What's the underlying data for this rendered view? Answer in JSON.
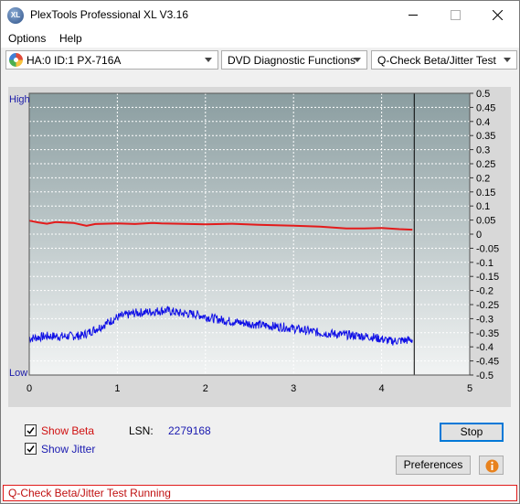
{
  "window": {
    "title": "PlexTools Professional XL V3.16",
    "icon": "plextools-xl-icon"
  },
  "menu": {
    "options": "Options",
    "help": "Help"
  },
  "toolbar": {
    "drive": "HA:0 ID:1  PX-716A",
    "function": "DVD Diagnostic Functions",
    "test": "Q-Check Beta/Jitter Test"
  },
  "chart": {
    "high_label": "High",
    "low_label": "Low",
    "x_ticks": [
      "0",
      "1",
      "2",
      "3",
      "4",
      "5"
    ],
    "y_ticks": [
      "0.5",
      "0.45",
      "0.4",
      "0.35",
      "0.3",
      "0.25",
      "0.2",
      "0.15",
      "0.1",
      "0.05",
      "0",
      "-0.05",
      "-0.1",
      "-0.15",
      "-0.2",
      "-0.25",
      "-0.3",
      "-0.35",
      "-0.4",
      "-0.45",
      "-0.5"
    ]
  },
  "chart_data": {
    "type": "line",
    "xlim": [
      0,
      5
    ],
    "ylim": [
      -0.5,
      0.5
    ],
    "grid": true,
    "end_marker_x": 4.37,
    "series": [
      {
        "color": "#e31b1b",
        "x": [
          0,
          0.1,
          0.2,
          0.3,
          0.5,
          0.65,
          0.75,
          1.0,
          1.2,
          1.4,
          1.5,
          1.7,
          2.0,
          2.3,
          2.6,
          3.0,
          3.3,
          3.6,
          3.8,
          4.0,
          4.2,
          4.35
        ],
        "values": [
          0.048,
          0.042,
          0.037,
          0.043,
          0.04,
          0.03,
          0.036,
          0.038,
          0.036,
          0.04,
          0.038,
          0.037,
          0.035,
          0.037,
          0.033,
          0.03,
          0.027,
          0.02,
          0.02,
          0.022,
          0.018,
          0.016
        ]
      },
      {
        "color": "#1010e6",
        "x": [
          0,
          0.2,
          0.4,
          0.6,
          0.8,
          1.0,
          1.2,
          1.4,
          1.55,
          1.7,
          1.9,
          2.1,
          2.3,
          2.5,
          2.7,
          2.9,
          3.1,
          3.3,
          3.5,
          3.7,
          3.9,
          4.1,
          4.2,
          4.35
        ],
        "values": [
          -0.37,
          -0.362,
          -0.363,
          -0.36,
          -0.33,
          -0.295,
          -0.28,
          -0.275,
          -0.27,
          -0.28,
          -0.285,
          -0.3,
          -0.31,
          -0.318,
          -0.325,
          -0.33,
          -0.34,
          -0.35,
          -0.355,
          -0.36,
          -0.365,
          -0.38,
          -0.378,
          -0.375
        ],
        "spread": 0.016
      }
    ]
  },
  "controls": {
    "show_beta": "Show Beta",
    "show_jitter": "Show Jitter",
    "lsn_label": "LSN:",
    "lsn_value": "2279168",
    "stop": "Stop",
    "preferences": "Preferences"
  },
  "status": {
    "text": "Q-Check Beta/Jitter Test Running"
  }
}
